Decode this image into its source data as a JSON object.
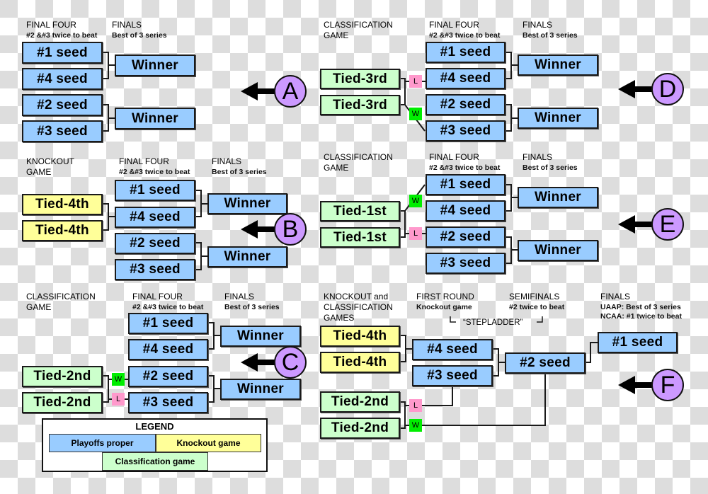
{
  "colors": {
    "playoffs": "#99ccff",
    "knockout": "#ffff99",
    "classification": "#ccffcc",
    "loser_badge": "#ff99cc",
    "winner_badge": "#00ee00",
    "marker": "#cc99ff"
  },
  "sections": {
    "A": {
      "marker": "A",
      "headers": [
        {
          "title": "FINAL FOUR",
          "sub": "#2 &#3 twice to beat"
        },
        {
          "title": "FINALS",
          "sub": "Best of 3 series"
        }
      ],
      "seeds": [
        "#1 seed",
        "#4 seed",
        "#2 seed",
        "#3 seed"
      ],
      "finals": [
        "Winner",
        "Winner"
      ]
    },
    "B": {
      "marker": "B",
      "headers": [
        {
          "title": "KNOCKOUT",
          "title2": "GAME"
        },
        {
          "title": "FINAL FOUR",
          "sub": "#2 &#3 twice to beat"
        },
        {
          "title": "FINALS",
          "sub": "Best of 3 series"
        }
      ],
      "pre": [
        "Tied-4th",
        "Tied-4th"
      ],
      "seeds": [
        "#1 seed",
        "#4 seed",
        "#2 seed",
        "#3 seed"
      ],
      "finals": [
        "Winner",
        "Winner"
      ]
    },
    "C": {
      "marker": "C",
      "headers": [
        {
          "title": "CLASSIFICATION",
          "title2": "GAME"
        },
        {
          "title": "FINAL FOUR",
          "sub": "#2 &#3 twice to beat"
        },
        {
          "title": "FINALS",
          "sub": "Best of 3 series"
        }
      ],
      "pre": [
        "Tied-2nd",
        "Tied-2nd"
      ],
      "badges": [
        "W",
        "L"
      ],
      "seeds": [
        "#1 seed",
        "#4 seed",
        "#2 seed",
        "#3 seed"
      ],
      "finals": [
        "Winner",
        "Winner"
      ]
    },
    "D": {
      "marker": "D",
      "headers": [
        {
          "title": "CLASSIFICATION",
          "title2": "GAME"
        },
        {
          "title": "FINAL FOUR",
          "sub": "#2 &#3 twice to beat"
        },
        {
          "title": "FINALS",
          "sub": "Best of 3 series"
        }
      ],
      "pre": [
        "Tied-3rd",
        "Tied-3rd"
      ],
      "badges": [
        "L",
        "W"
      ],
      "seeds": [
        "#1 seed",
        "#4 seed",
        "#2 seed",
        "#3 seed"
      ],
      "finals": [
        "Winner",
        "Winner"
      ]
    },
    "E": {
      "marker": "E",
      "headers": [
        {
          "title": "CLASSIFICATION",
          "title2": "GAME"
        },
        {
          "title": "FINAL FOUR",
          "sub": "#2 &#3 twice to beat"
        },
        {
          "title": "FINALS",
          "sub": "Best of 3 series"
        }
      ],
      "pre": [
        "Tied-1st",
        "Tied-1st"
      ],
      "badges": [
        "W",
        "L"
      ],
      "seeds": [
        "#1 seed",
        "#4 seed",
        "#2 seed",
        "#3 seed"
      ],
      "finals": [
        "Winner",
        "Winner"
      ]
    },
    "F": {
      "marker": "F",
      "headers": [
        {
          "title": "KNOCKOUT and",
          "title2": "CLASSIFICATION",
          "title3": "GAMES"
        },
        {
          "title": "FIRST ROUND",
          "sub": "Knockout game"
        },
        {
          "title": "SEMIFINALS",
          "sub": "#2  twice to beat"
        },
        {
          "title": "FINALS",
          "sub": "UAAP: Best of 3 series",
          "sub2": "NCAA: #1 twice to beat"
        }
      ],
      "stepladder": "“STEPLADDER”",
      "knockout": [
        "Tied-4th",
        "Tied-4th"
      ],
      "classification": [
        "Tied-2nd",
        "Tied-2nd"
      ],
      "badges": [
        "L",
        "W"
      ],
      "first_round": [
        "#4 seed",
        "#3 seed"
      ],
      "semifinal": "#2 seed",
      "final": "#1 seed"
    }
  },
  "legend": {
    "title": "LEGEND",
    "items": [
      "Playoffs proper",
      "Knockout game",
      "Classification game"
    ]
  }
}
